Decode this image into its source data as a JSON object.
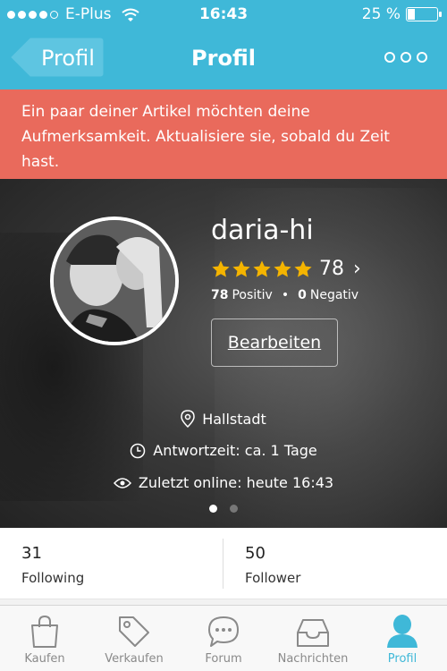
{
  "status_bar": {
    "carrier": "E-Plus",
    "time": "16:43",
    "battery": "25 %",
    "battery_level": 0.25,
    "signal_bars": 4,
    "signal_total": 5
  },
  "nav": {
    "back_label": "Profil",
    "title": "Profil"
  },
  "banner": {
    "message": "Ein paar deiner Artikel möchten deine Aufmerksamkeit. Aktualisiere sie, sobald du Zeit hast."
  },
  "profile": {
    "username": "daria-hi",
    "stars": 5,
    "rating_count": "78",
    "positive_count": "78",
    "positive_label": "Positiv",
    "negative_count": "0",
    "negative_label": "Negativ",
    "edit_label": "Bearbeiten",
    "location": "Hallstadt",
    "response_time": "Antwortzeit: ca. 1 Tage",
    "last_online": "Zuletzt online: heute 16:43",
    "pages": 2,
    "active_page": 0
  },
  "stats": {
    "following_count": "31",
    "following_label": "Following",
    "follower_count": "50",
    "follower_label": "Follower"
  },
  "tabs": [
    {
      "label": "Kaufen",
      "icon": "shopping-bag-icon"
    },
    {
      "label": "Verkaufen",
      "icon": "price-tag-icon"
    },
    {
      "label": "Forum",
      "icon": "chat-bubble-icon"
    },
    {
      "label": "Nachrichten",
      "icon": "inbox-icon"
    },
    {
      "label": "Profil",
      "icon": "person-icon",
      "active": true
    }
  ],
  "colors": {
    "accent": "#3fb8d8",
    "banner": "#e96a5c",
    "star": "#f4b400"
  }
}
